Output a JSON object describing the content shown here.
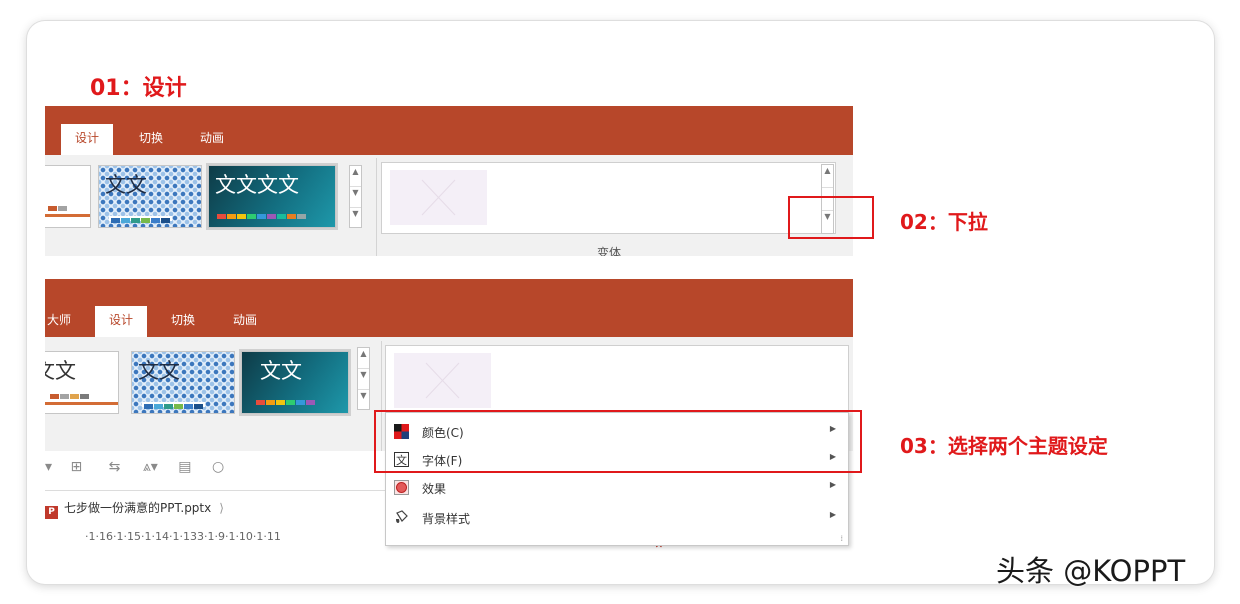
{
  "annotations": {
    "step1": "01：设计",
    "step2": "02：下拉",
    "step3": "03：选择两个主题设定"
  },
  "top_ribbon": {
    "tabs": [
      "设计",
      "切换",
      "动画"
    ],
    "active_tab": "设计",
    "thumbs": [
      {
        "text": "",
        "style": "white"
      },
      {
        "text": "文文",
        "style": "pattern"
      },
      {
        "text": "文文文文",
        "style": "teal"
      }
    ],
    "variants_label": "变体"
  },
  "bottom_ribbon": {
    "tabs": [
      "大师",
      "设计",
      "切换",
      "动画"
    ],
    "active_tab": "设计",
    "thumbs": [
      {
        "text": "文文",
        "style": "white"
      },
      {
        "text": "文文",
        "style": "pattern"
      },
      {
        "text": "文文",
        "style": "teal"
      }
    ]
  },
  "dropdown_menu": {
    "items": [
      {
        "label": "颜色(C)",
        "icon": "color-palette-icon",
        "has_submenu": true
      },
      {
        "label": "字体(F)",
        "icon": "font-icon",
        "has_submenu": true
      },
      {
        "label": "效果",
        "icon": "effects-icon",
        "has_submenu": true
      },
      {
        "label": "背景样式",
        "icon": "background-style-icon",
        "has_submenu": true
      }
    ]
  },
  "file_tab": {
    "label": "七步做一份满意的PPT.pptx",
    "icon_letter": "P"
  },
  "ruler_text": "·1·16·1·15·1·14·1·133·1·9·1·10·1·11",
  "watermark": "头条 @KOPPT",
  "colors": {
    "ribbon": "#b7472a",
    "highlight": "#e0191b"
  }
}
